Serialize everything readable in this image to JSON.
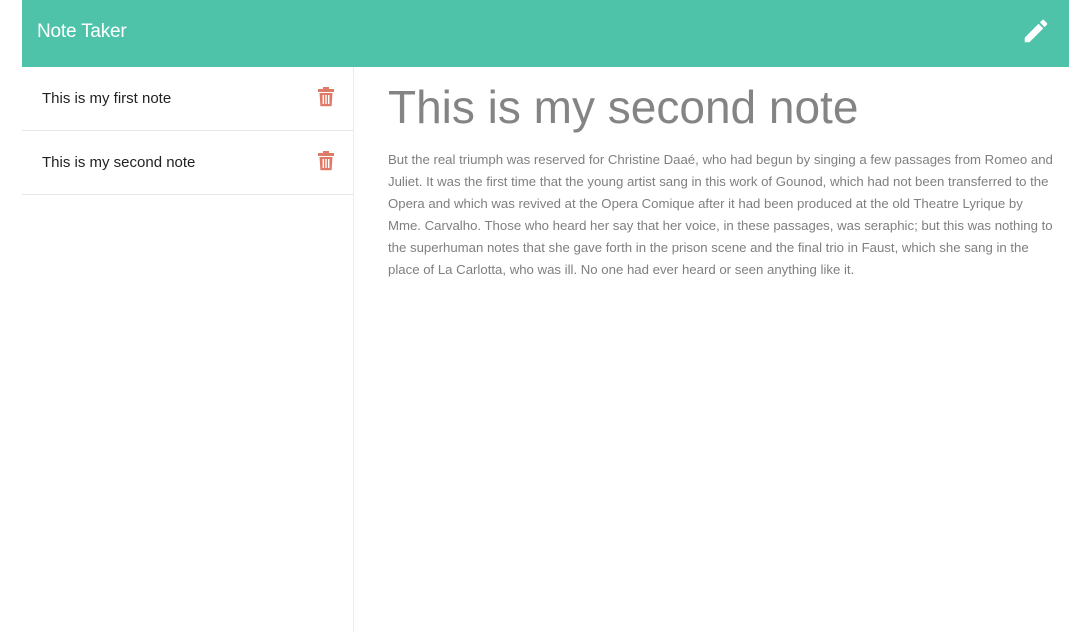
{
  "app": {
    "brand": "Note Taker"
  },
  "toolbar": {
    "new_note_icon": "pencil-icon"
  },
  "sidebar": {
    "notes": [
      {
        "title": "This is my first note",
        "delete_icon": "trash-icon"
      },
      {
        "title": "This is my second note",
        "delete_icon": "trash-icon"
      }
    ]
  },
  "active_note": {
    "title": "This is my second note",
    "text": "But the real triumph was reserved for Christine Daaé, who had begun by singing a few passages from Romeo and Juliet. It was the first time that the young artist sang in this work of Gounod, which had not been transferred to the Opera and which was revived at the Opera Comique after it had been produced at the old Theatre Lyrique by Mme. Carvalho. Those who heard her say that her voice, in these passages, was seraphic; but this was nothing to the superhuman notes that she gave forth in the prison scene and the final trio in Faust, which she sang in the place of La Carlotta, who was ill. No one had ever heard or seen anything like it."
  },
  "colors": {
    "navbar": "#4fc3aa",
    "delete_icon": "#e07a68",
    "heading": "#848484",
    "body_text": "#7f7f7f"
  }
}
